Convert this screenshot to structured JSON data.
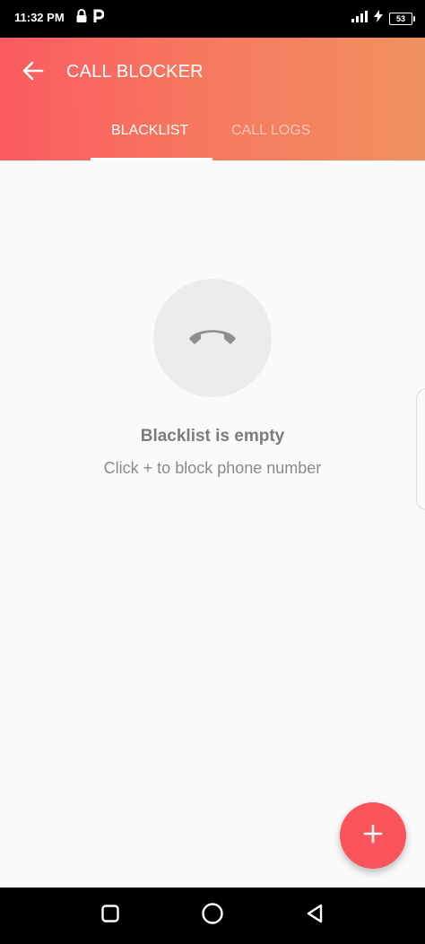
{
  "status_bar": {
    "time": "11:32 PM",
    "battery": "53",
    "icons": [
      "lock-icon",
      "p-icon",
      "signal-icon",
      "charging-icon",
      "battery-icon"
    ]
  },
  "app_bar": {
    "title": "CALL BLOCKER",
    "back_icon": "arrow-left-icon",
    "tabs": [
      {
        "label": "BLACKLIST",
        "selected": true
      },
      {
        "label": "CALL LOGS",
        "selected": false
      }
    ],
    "colors": {
      "gradient_start": "#fb5b60",
      "gradient_end": "#ee915f"
    }
  },
  "empty_state": {
    "icon": "phone-hangup-icon",
    "title": "Blacklist is empty",
    "subtitle": "Click + to block phone number"
  },
  "fab": {
    "label": "+",
    "icon": "plus-icon",
    "color": "#fb555b"
  },
  "nav_bar": {
    "buttons": [
      "recents-square-icon",
      "home-circle-icon",
      "back-triangle-icon"
    ]
  }
}
